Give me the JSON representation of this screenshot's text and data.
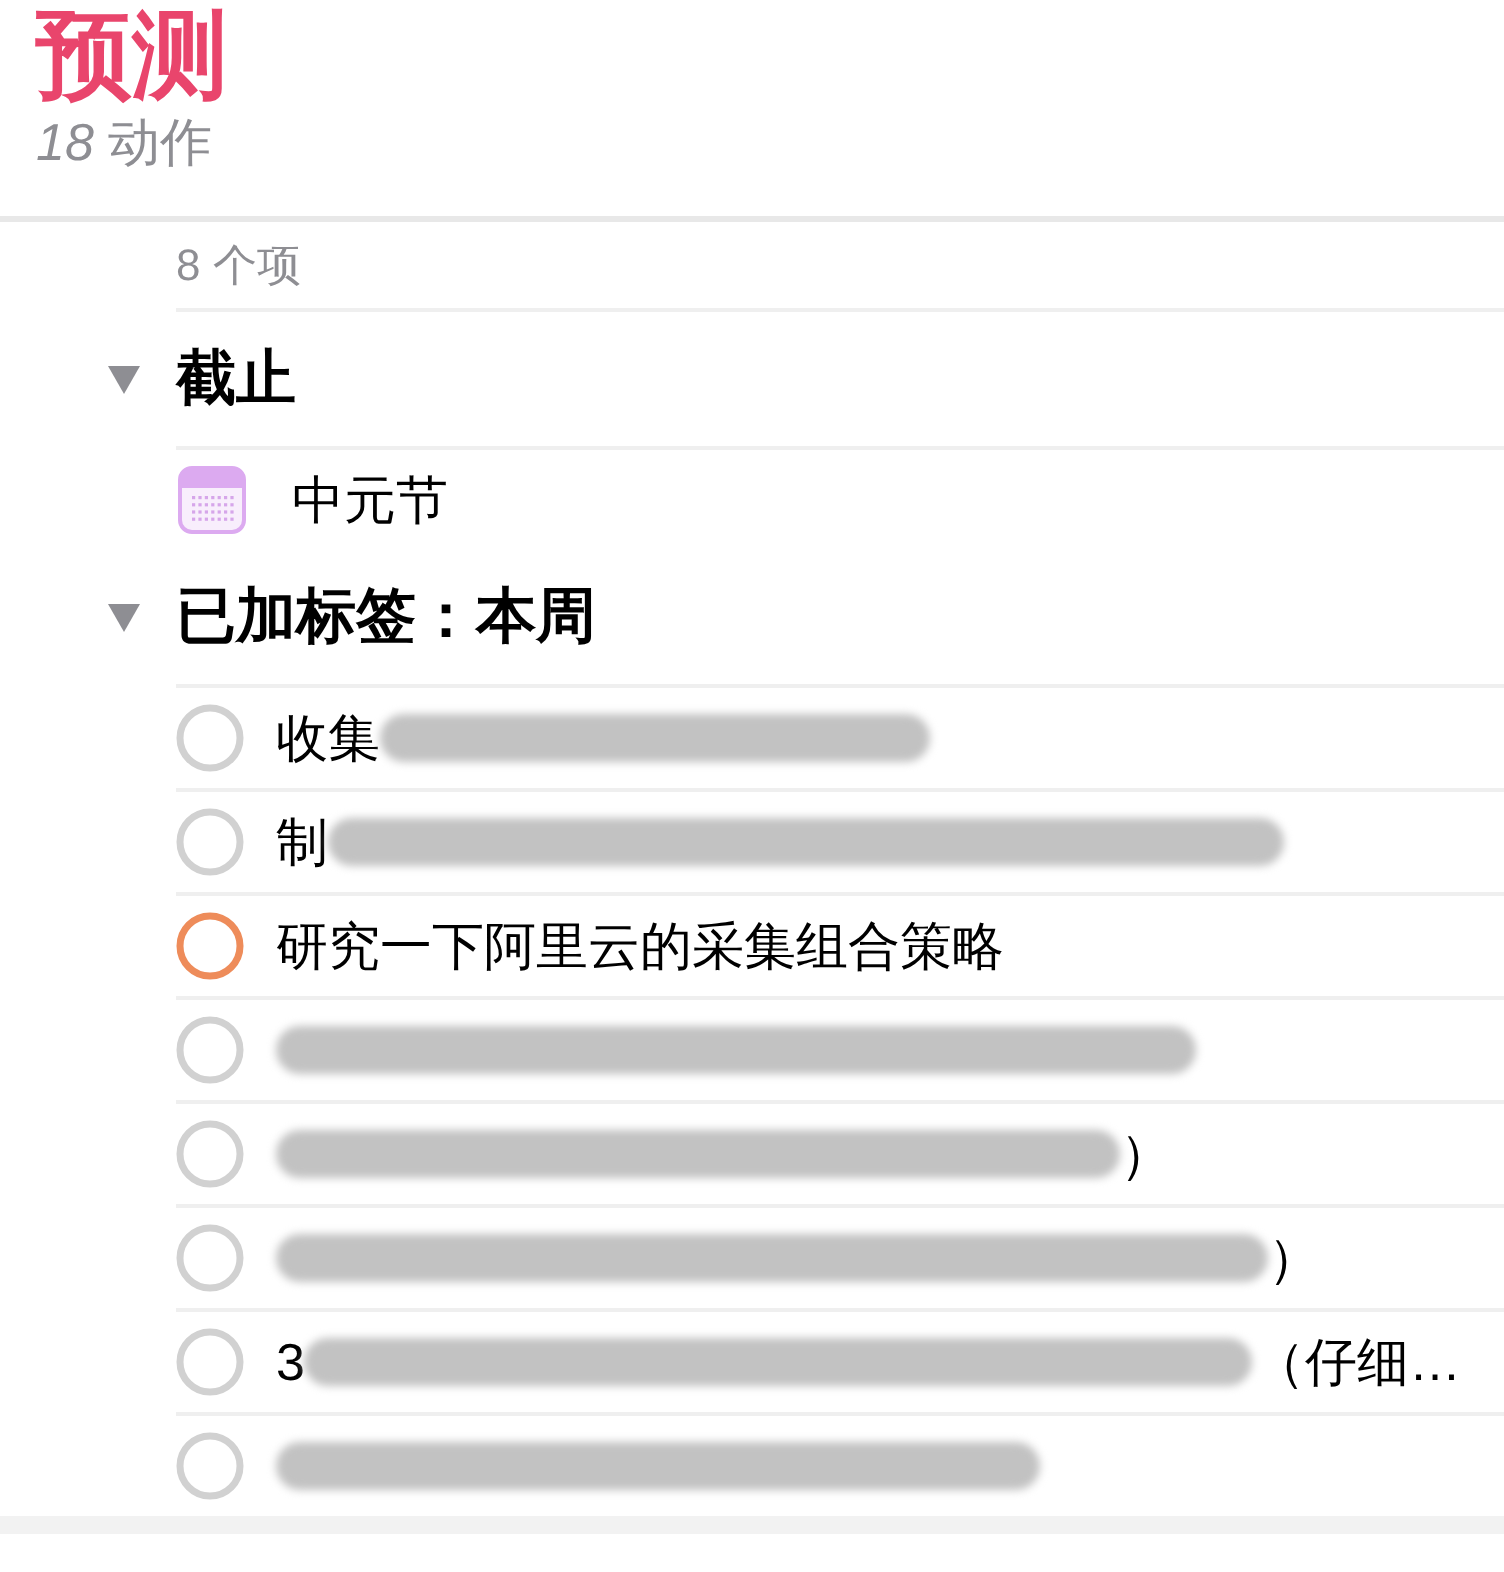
{
  "header": {
    "title": "预测",
    "subtitle": "*18* 动作"
  },
  "summary": "8 个项",
  "sections": [
    {
      "title": "截止",
      "expanded": true,
      "items": [
        {
          "kind": "event",
          "text": "中元节"
        }
      ]
    },
    {
      "title": "已加标签：本周",
      "expanded": true,
      "items": [
        {
          "kind": "action",
          "color": "#d1d1d1",
          "parts": [
            {
              "kind": "text",
              "text": "收集"
            },
            {
              "kind": "blurred"
            }
          ]
        },
        {
          "kind": "action",
          "color": "#d1d1d1",
          "parts": [
            {
              "kind": "text",
              "text": "制"
            },
            {
              "kind": "blurred"
            }
          ]
        },
        {
          "kind": "action",
          "color": "#ee8c5a",
          "parts": [
            {
              "kind": "text",
              "text": "研究一下阿里云的采集组合策略"
            }
          ]
        },
        {
          "kind": "action",
          "color": "#d1d1d1",
          "parts": [
            {
              "kind": "blurred"
            }
          ]
        },
        {
          "kind": "action",
          "color": "#d1d1d1",
          "parts": [
            {
              "kind": "blurred"
            },
            {
              "kind": "text",
              "text": "）"
            }
          ]
        },
        {
          "kind": "action",
          "color": "#d1d1d1",
          "parts": [
            {
              "kind": "blurred"
            },
            {
              "kind": "text",
              "text": "）"
            }
          ]
        },
        {
          "kind": "action",
          "color": "#d1d1d1",
          "parts": [
            {
              "kind": "text",
              "text": "3"
            },
            {
              "kind": "blurred"
            },
            {
              "kind": "text",
              "text": "（仔细…"
            }
          ]
        },
        {
          "kind": "action",
          "color": "#d1d1d1",
          "parts": [
            {
              "kind": "blurred"
            }
          ]
        }
      ]
    }
  ]
}
